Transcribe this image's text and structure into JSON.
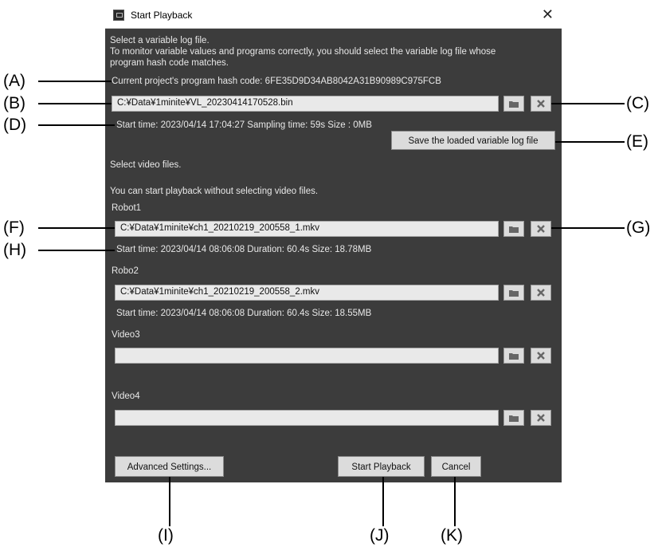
{
  "window": {
    "title": "Start Playback"
  },
  "log": {
    "intro_1": "Select a variable log file.",
    "intro_2": "To monitor variable values and programs correctly, you should select the variable log file whose",
    "intro_3": "program hash code matches.",
    "hash_line": "Current project's program hash code:  6FE35D9D34AB8042A31B90989C975FCB",
    "file_path": "C:¥Data¥1minite¥VL_20230414170528.bin",
    "info": "Start time: 2023/04/14 17:04:27    Sampling time: 59s    Size : 0MB",
    "save_button": "Save the loaded variable log file"
  },
  "video": {
    "select_label": "Select video files.",
    "hint": "You can start playback without selecting video files.",
    "slots": [
      {
        "label": "Robot1",
        "path": "C:¥Data¥1minite¥ch1_20210219_200558_1.mkv",
        "info": "Start time: 2023/04/14 08:06:08      Duration: 60.4s    Size: 18.78MB"
      },
      {
        "label": "Robo2",
        "path": "C:¥Data¥1minite¥ch1_20210219_200558_2.mkv",
        "info": "Start time: 2023/04/14 08:06:08      Duration: 60.4s    Size: 18.55MB"
      },
      {
        "label": "Video3",
        "path": "",
        "info": ""
      },
      {
        "label": "Video4",
        "path": "",
        "info": ""
      }
    ]
  },
  "buttons": {
    "advanced": "Advanced Settings...",
    "start": "Start Playback",
    "cancel": "Cancel"
  },
  "callouts": {
    "A": "(A)",
    "B": "(B)",
    "C": "(C)",
    "D": "(D)",
    "E": "(E)",
    "F": "(F)",
    "G": "(G)",
    "H": "(H)",
    "I": "(I)",
    "J": "(J)",
    "K": "(K)"
  },
  "icons": {
    "browse": "folder-icon",
    "clear": "x-icon",
    "close": "close-icon"
  }
}
